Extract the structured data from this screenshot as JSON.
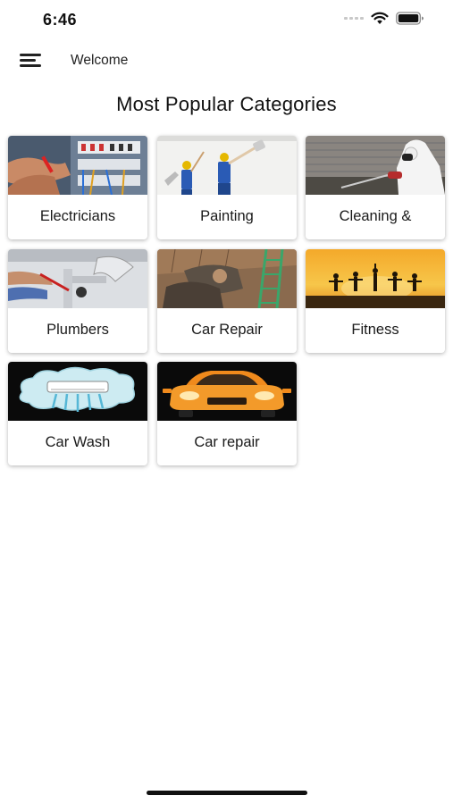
{
  "status_bar": {
    "time": "6:46"
  },
  "header": {
    "title": "Welcome"
  },
  "page": {
    "title": "Most Popular Categories"
  },
  "categories": [
    {
      "label": "Electricians",
      "icon": "electrician-photo"
    },
    {
      "label": "Painting",
      "icon": "painting-photo"
    },
    {
      "label": "Cleaning &",
      "icon": "cleaning-photo"
    },
    {
      "label": "Plumbers",
      "icon": "plumbing-photo"
    },
    {
      "label": "Car Repair",
      "icon": "car-repair-photo"
    },
    {
      "label": "Fitness",
      "icon": "fitness-photo"
    },
    {
      "label": "Car Wash",
      "icon": "car-wash-image"
    },
    {
      "label": "Car repair",
      "icon": "car-image"
    }
  ]
}
